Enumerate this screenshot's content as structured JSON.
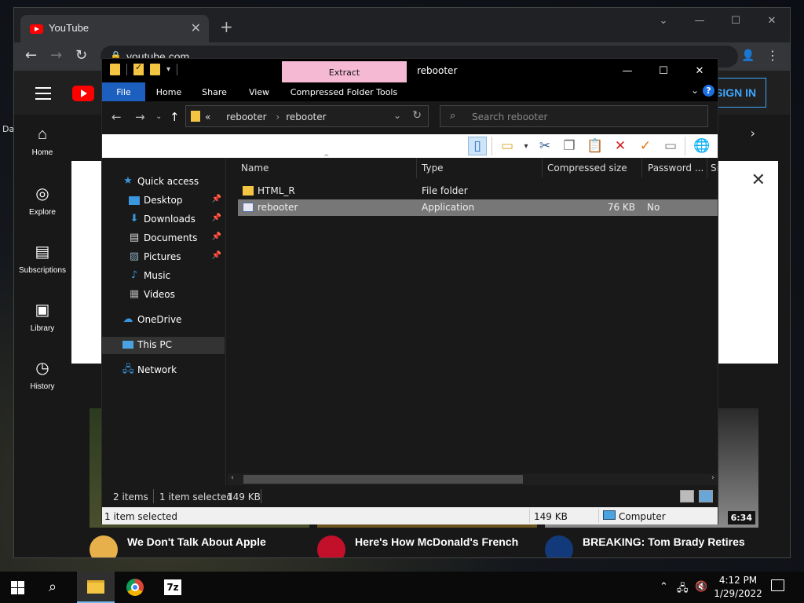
{
  "desktop": {
    "fragment_text": "Da"
  },
  "browser": {
    "tab_title": "YouTube",
    "tab_close": "✕",
    "new_tab": "+",
    "url": "youtube.com",
    "signin_label": "SIGN IN",
    "sidebar": [
      {
        "label": "Home",
        "icon": "home-icon"
      },
      {
        "label": "Explore",
        "icon": "compass-icon"
      },
      {
        "label": "Subscriptions",
        "icon": "subscriptions-icon"
      },
      {
        "label": "Library",
        "icon": "library-icon"
      },
      {
        "label": "History",
        "icon": "history-icon"
      }
    ],
    "videos": [
      {
        "title": "We Don't Talk About Apple"
      },
      {
        "title": "Here's How McDonald's French"
      },
      {
        "title": "BREAKING: Tom Brady Retires",
        "duration": "6:34"
      }
    ]
  },
  "explorer": {
    "quick_tab_label": "Extract",
    "window_title": "rebooter",
    "ribbon_tabs": [
      "File",
      "Home",
      "Share",
      "View",
      "Compressed Folder Tools"
    ],
    "address": {
      "overflow": "«",
      "crumbs": [
        "rebooter",
        "rebooter"
      ]
    },
    "search_placeholder": "Search rebooter",
    "nav": {
      "quick_access": "Quick access",
      "desktop": "Desktop",
      "downloads": "Downloads",
      "documents": "Documents",
      "pictures": "Pictures",
      "music": "Music",
      "videos": "Videos",
      "onedrive": "OneDrive",
      "this_pc": "This PC",
      "network": "Network"
    },
    "columns": [
      "Name",
      "Type",
      "Compressed size",
      "Password ...",
      "Si"
    ],
    "files": [
      {
        "name": "HTML_R",
        "type": "File folder",
        "size": "",
        "password": "",
        "icon": "folder-icon"
      },
      {
        "name": "rebooter",
        "type": "Application",
        "size": "76 KB",
        "password": "No",
        "icon": "application-icon"
      }
    ],
    "status": {
      "items": "2 items",
      "selected": "1 item selected",
      "selected_size": "149 KB",
      "details_selected": "1 item selected",
      "details_size": "149 KB",
      "zone": "Computer"
    }
  },
  "taskbar": {
    "time": "4:12 PM",
    "date": "1/29/2022",
    "sevenzip_label": "7z"
  }
}
